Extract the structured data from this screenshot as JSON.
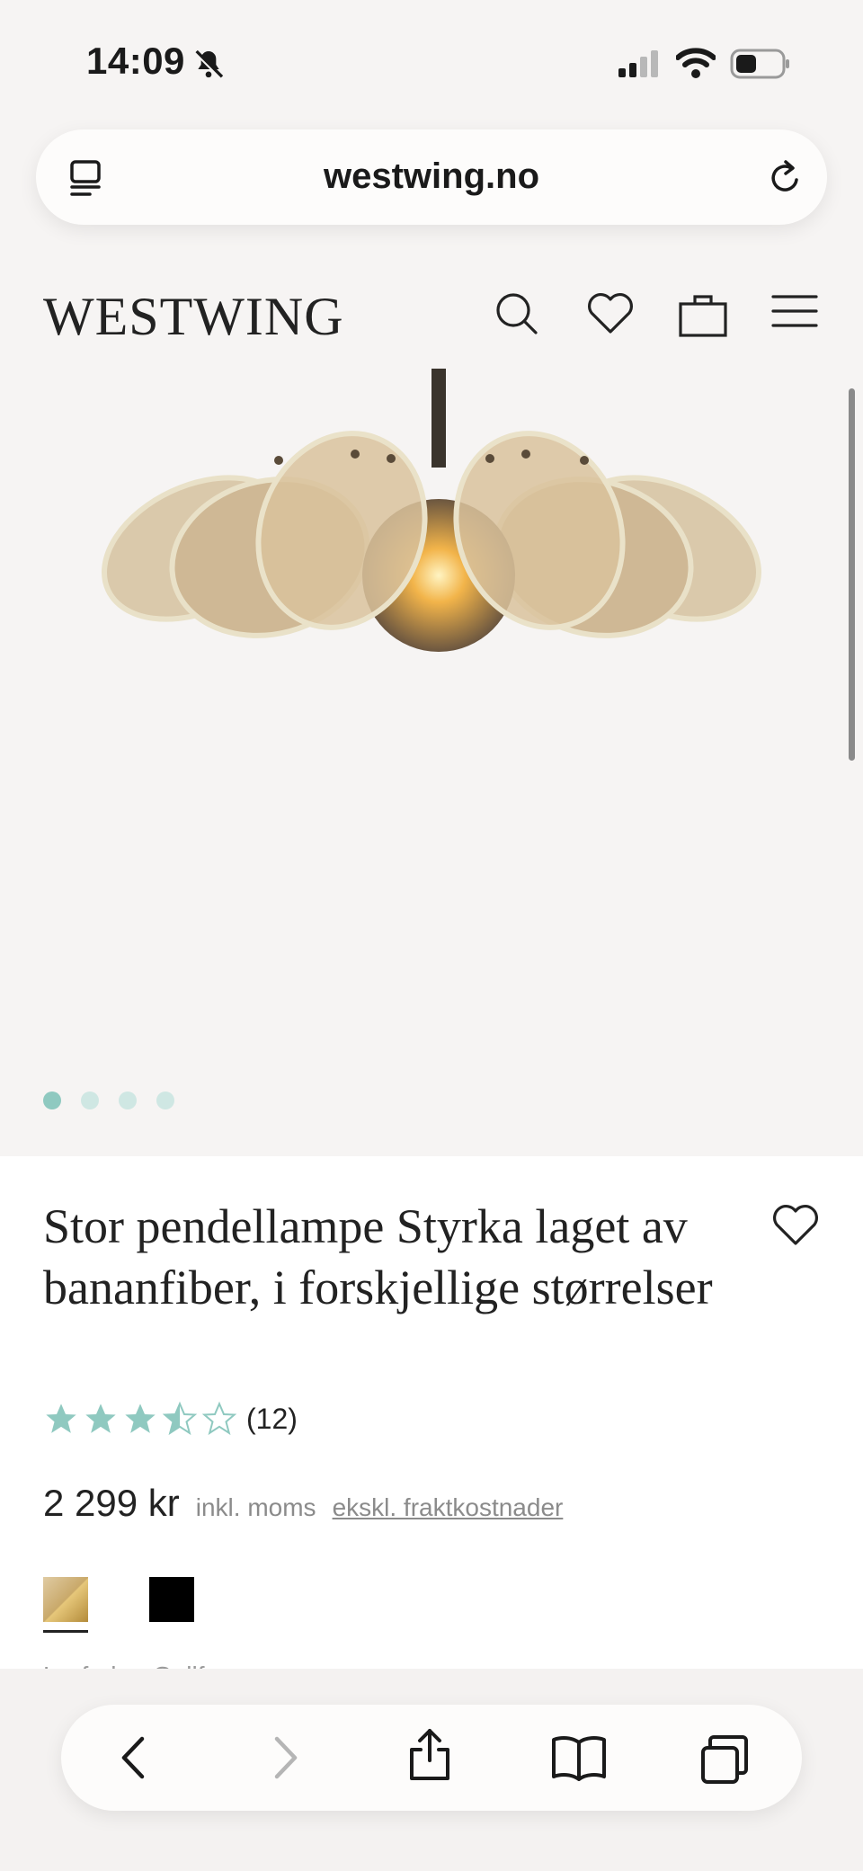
{
  "status_bar": {
    "time": "14:09"
  },
  "browser": {
    "url": "westwing.no"
  },
  "site": {
    "logo": "WESTWING"
  },
  "gallery": {
    "slide_count": 4,
    "active_slide": 1
  },
  "product": {
    "title": "Stor pendellampe Styrka laget av bananfiber, i forskjellige størrelser",
    "rating": 3.5,
    "rating_max": 5,
    "review_count": "(12)",
    "price": "2 299 kr",
    "vat_note": "inkl. moms",
    "shipping_link": "ekskl. fraktkostnader",
    "colors": [
      {
        "name": "gold",
        "hex": "#c9a96a",
        "selected": true
      },
      {
        "name": "black",
        "hex": "#000000",
        "selected": false
      }
    ],
    "partial_text": "Lysfarbe: Gullfa"
  },
  "theme": {
    "accent": "#8fc9c0",
    "accent_light": "#cfe7e3",
    "text": "#222222",
    "muted": "#8b8b8b"
  }
}
